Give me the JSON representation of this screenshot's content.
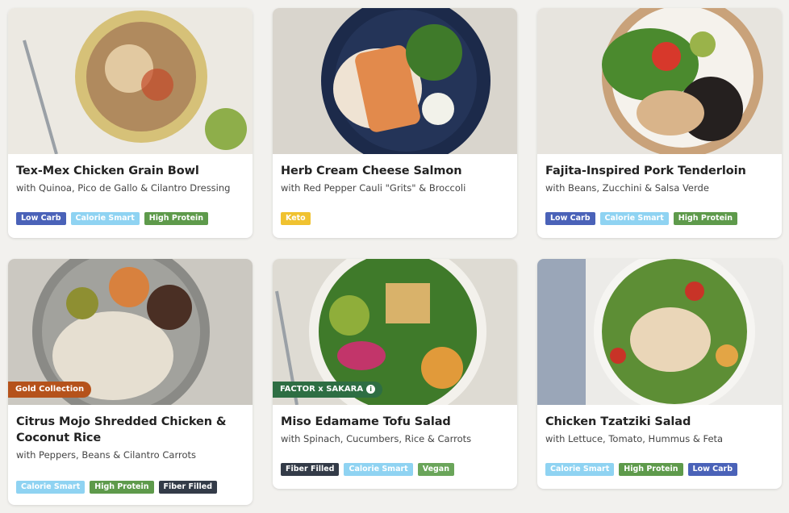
{
  "tag_colors": {
    "Low Carb": "#4a62b8",
    "Calorie Smart": "#8fd3f2",
    "High Protein": "#5e9a4b",
    "Keto": "#f0c230",
    "Fiber Filled": "#333b48",
    "Vegan": "#6aa55a"
  },
  "meals": [
    {
      "title": "Tex-Mex Chicken Grain Bowl",
      "subtitle": "with Quinoa, Pico de Gallo & Cilantro Dressing",
      "tags": [
        "Low Carb",
        "Calorie Smart",
        "High Protein"
      ],
      "image": "bowl-grain-chicken"
    },
    {
      "title": "Herb Cream Cheese Salmon",
      "subtitle": "with Red Pepper Cauli \"Grits\" & Broccoli",
      "tags": [
        "Keto"
      ],
      "image": "salmon-plate"
    },
    {
      "title": "Fajita-Inspired Pork Tenderloin",
      "subtitle": "with Beans, Zucchini & Salsa Verde",
      "tags": [
        "Low Carb",
        "Calorie Smart",
        "High Protein"
      ],
      "image": "pork-plate"
    },
    {
      "title": "Citrus Mojo Shredded Chicken & Coconut Rice",
      "subtitle": "with Peppers, Beans & Cilantro Carrots",
      "tags": [
        "Calorie Smart",
        "High Protein",
        "Fiber Filled"
      ],
      "badge": "Gold Collection",
      "badge_color": "#b5521b",
      "image": "shredded-chicken-plate"
    },
    {
      "title": "Miso Edamame Tofu Salad",
      "subtitle": "with Spinach, Cucumbers, Rice & Carrots",
      "tags": [
        "Fiber Filled",
        "Calorie Smart",
        "Vegan"
      ],
      "badge": "FACTOR x SAKARA",
      "badge_color": "#2e6e43",
      "image": "tofu-salad-bowl"
    },
    {
      "title": "Chicken Tzatziki Salad",
      "subtitle": "with Lettuce, Tomato, Hummus & Feta",
      "tags": [
        "Calorie Smart",
        "High Protein",
        "Low Carb"
      ],
      "image": "tzatziki-salad-bowl"
    }
  ]
}
